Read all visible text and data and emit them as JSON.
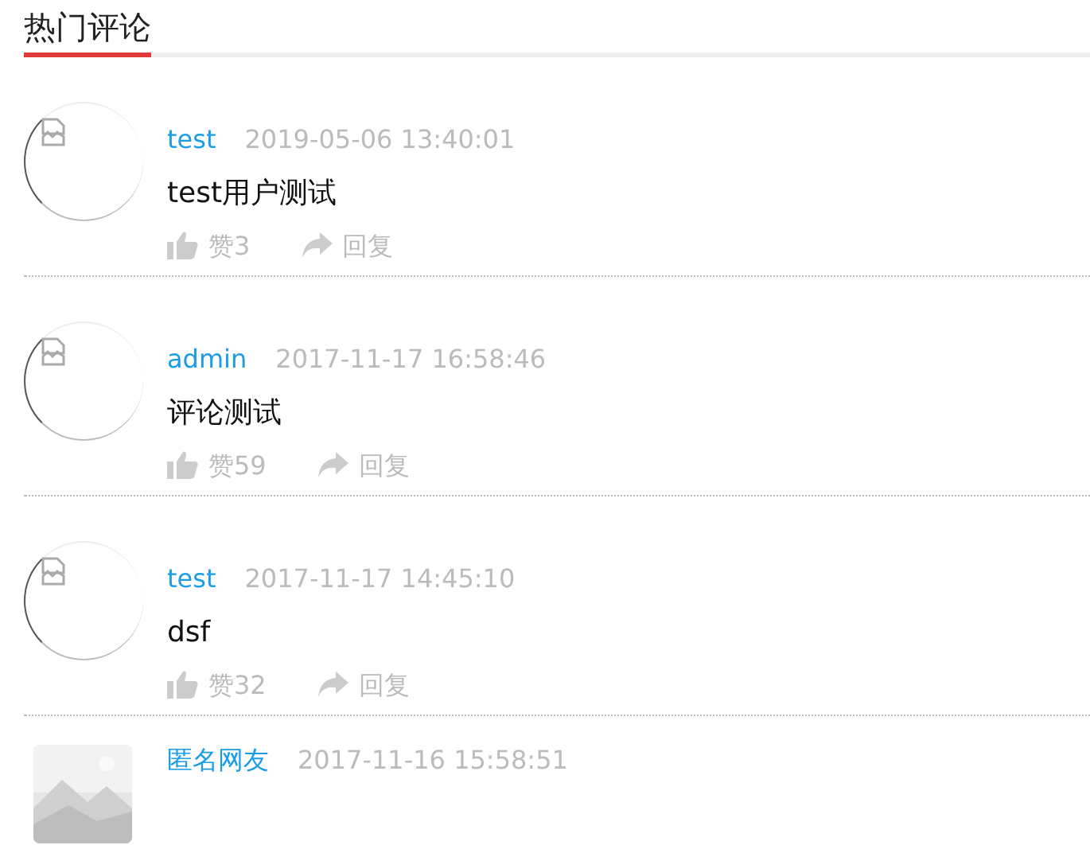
{
  "section": {
    "title": "热门评论"
  },
  "comments": [
    {
      "kind": "broken",
      "user": "test",
      "time": "2019-05-06 13:40:01",
      "text": "test用户测试",
      "likes": "赞3",
      "reply": "回复"
    },
    {
      "kind": "broken",
      "user": "admin",
      "time": "2017-11-17 16:58:46",
      "text": "评论测试",
      "likes": "赞59",
      "reply": "回复"
    },
    {
      "kind": "broken",
      "user": "test",
      "time": "2017-11-17 14:45:10",
      "text": "dsf",
      "likes": "赞32",
      "reply": "回复"
    },
    {
      "kind": "picture",
      "user": "匿名网友",
      "time": "2017-11-16 15:58:51"
    }
  ]
}
